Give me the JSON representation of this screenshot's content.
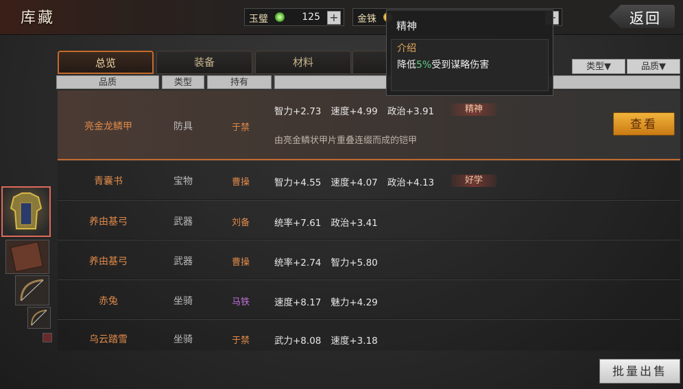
{
  "header": {
    "title": "库藏",
    "back_label": "返回"
  },
  "resources": [
    {
      "label": "玉璧",
      "value": "125",
      "icon": "jade-icon",
      "color": "#5fbf3a"
    },
    {
      "label": "金铢",
      "value": "",
      "icon": "coin-icon",
      "color": "#e8b430"
    }
  ],
  "tabs": [
    "总览",
    "装备",
    "材料",
    ""
  ],
  "filters": {
    "type": "类型▼",
    "quality": "品质▼"
  },
  "columns": {
    "quality": "品质",
    "type": "类型",
    "owner": "持有"
  },
  "items": [
    {
      "name": "亮金龙鳞甲",
      "type": "防具",
      "owner": "于禁",
      "owner_color": "#e08a4a",
      "stats": [
        "智力+2.73",
        "速度+4.99",
        "政治+3.91"
      ],
      "trait": "精神",
      "desc": "由亮金鳞状甲片重叠连缀而成的铠甲",
      "action": "查看"
    },
    {
      "name": "青囊书",
      "type": "宝物",
      "owner": "曹操",
      "owner_color": "#e08a4a",
      "stats": [
        "智力+4.55",
        "速度+4.07",
        "政治+4.13"
      ],
      "trait": "好学"
    },
    {
      "name": "养由基弓",
      "type": "武器",
      "owner": "刘备",
      "owner_color": "#e08a4a",
      "stats": [
        "统率+7.61",
        "政治+3.41"
      ]
    },
    {
      "name": "养由基弓",
      "type": "武器",
      "owner": "曹操",
      "owner_color": "#e08a4a",
      "stats": [
        "统率+2.74",
        "智力+5.80"
      ]
    },
    {
      "name": "赤兔",
      "type": "坐骑",
      "owner": "马铁",
      "owner_color": "#c070d8",
      "stats": [
        "速度+8.17",
        "魅力+4.29"
      ]
    },
    {
      "name": "乌云踏雪",
      "type": "坐骑",
      "owner": "于禁",
      "owner_color": "#e08a4a",
      "stats": [
        "武力+8.08",
        "速度+3.18"
      ]
    }
  ],
  "tooltip": {
    "title": "精神",
    "subtitle": "介绍",
    "body_prefix": "降低",
    "body_highlight": "5%",
    "body_suffix": "受到谋略伤害"
  },
  "bulk_sell": "批量出售"
}
